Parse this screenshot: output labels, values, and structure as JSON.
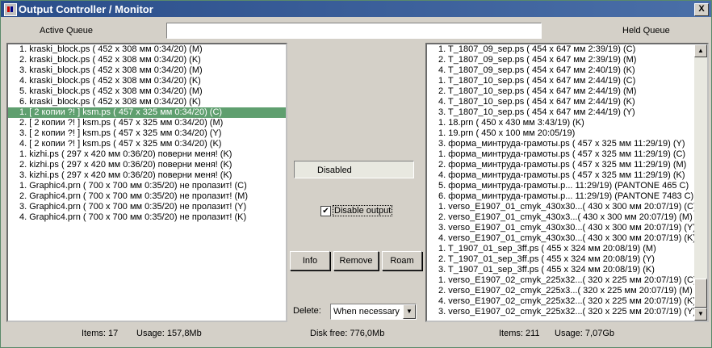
{
  "window": {
    "title": "Output Controller / Monitor",
    "close_label": "X"
  },
  "labels": {
    "active_queue": "Active Queue",
    "held_queue": "Held Queue"
  },
  "active_queue": [
    "1. kraski_block.ps ( 452 x 308 мм  0:34/20) (M)",
    "2. kraski_block.ps ( 452 x 308 мм  0:34/20) (K)",
    "3. kraski_block.ps ( 452 x 308 мм  0:34/20) (M)",
    "4. kraski_block.ps ( 452 x 308 мм  0:34/20) (K)",
    "5. kraski_block.ps ( 452 x 308 мм  0:34/20) (M)",
    "6. kraski_block.ps ( 452 x 308 мм  0:34/20) (K)",
    "1. [ 2 копии ?! ]  ksm.ps ( 457 x 325 мм  0:34/20) (C)",
    "2. [ 2 копии ?! ]  ksm.ps ( 457 x 325 мм  0:34/20) (M)",
    "3. [ 2 копии ?! ]  ksm.ps ( 457 x 325 мм  0:34/20) (Y)",
    "4. [ 2 копии ?! ]  ksm.ps ( 457 x 325 мм  0:34/20) (K)",
    "1. kizhi.ps ( 297 x 420 мм  0:36/20) поверни меня! (K)",
    "2. kizhi.ps ( 297 x 420 мм  0:36/20) поверни меня! (K)",
    "3. kizhi.ps ( 297 x 420 мм  0:36/20) поверни меня! (K)",
    "1. Graphic4.prn ( 700 x 700 мм  0:35/20) не пролазит! (C)",
    "2. Graphic4.prn ( 700 x 700 мм  0:35/20) не пролазит! (M)",
    "3. Graphic4.prn ( 700 x 700 мм  0:35/20) не пролазит! (Y)",
    "4. Graphic4.prn ( 700 x 700 мм  0:35/20) не пролазит! (K)"
  ],
  "active_selected_index": 6,
  "held_queue": [
    "1. T_1807_09_sep.ps ( 454 x 647 мм  2:39/19) (C)",
    "2. T_1807_09_sep.ps ( 454 x 647 мм  2:39/19) (M)",
    "4. T_1807_09_sep.ps ( 454 x 647 мм  2:40/19) (K)",
    "1. T_1807_10_sep.ps ( 454 x 647 мм  2:44/19) (C)",
    "2. T_1807_10_sep.ps ( 454 x 647 мм  2:44/19) (M)",
    "4. T_1807_10_sep.ps ( 454 x 647 мм  2:44/19) (K)",
    "3. T_1807_10_sep.ps ( 454 x 647 мм  2:44/19) (Y)",
    "1. 18.prn ( 450 x 430 мм  3:43/19) (K)",
    "1. 19.prn ( 450 x 100 мм 20:05/19)",
    "3. форма_минтруда-грамоты.ps ( 457 x 325 мм 11:29/19) (Y)",
    "1. форма_минтруда-грамоты.ps ( 457 x 325 мм 11:29/19) (C)",
    "2. форма_минтруда-грамоты.ps ( 457 x 325 мм 11:29/19) (M)",
    "4. форма_минтруда-грамоты.ps ( 457 x 325 мм 11:29/19) (K)",
    "5. форма_минтруда-грамоты.p... 11:29/19) (PANTONE 465 C)",
    "6. форма_минтруда-грамоты.p... 11:29/19) (PANTONE 7483 C)",
    "1. verso_E1907_01_cmyk_430x30...( 430 x 300 мм 20:07/19) (C)",
    "2. verso_E1907_01_cmyk_430x3...( 430 x 300 мм 20:07/19) (M)",
    "3. verso_E1907_01_cmyk_430x30...( 430 x 300 мм 20:07/19) (Y)",
    "4. verso_E1907_01_cmyk_430x30...( 430 x 300 мм 20:07/19) (K)",
    "1. T_1907_01_sep_3ff.ps ( 455 x 324 мм 20:08/19) (M)",
    "2. T_1907_01_sep_3ff.ps ( 455 x 324 мм 20:08/19) (Y)",
    "3. T_1907_01_sep_3ff.ps ( 455 x 324 мм 20:08/19) (K)",
    "1. verso_E1907_02_cmyk_225x32...( 320 x 225 мм 20:07/19) (C)",
    "2. verso_E1907_02_cmyk_225x3...( 320 x 225 мм 20:07/19) (M)",
    "4. verso_E1907_02_cmyk_225x32...( 320 x 225 мм 20:07/19) (K)",
    "3. verso_E1907_02_cmyk_225x32...( 320 x 225 мм 20:07/19) (Y)"
  ],
  "status_text": "Disabled",
  "disable_output": {
    "label": "Disable output",
    "checked_mark": "✔"
  },
  "buttons": {
    "info": "Info",
    "remove": "Remove",
    "roam": "Roam"
  },
  "delete": {
    "label": "Delete:",
    "value": "When necessary"
  },
  "footer": {
    "left_items": "Items:  17",
    "left_usage": "Usage: 157,8Mb",
    "disk_free": "Disk free:  776,0Mb",
    "right_items": "Items:  211",
    "right_usage": "Usage: 7,07Gb"
  }
}
